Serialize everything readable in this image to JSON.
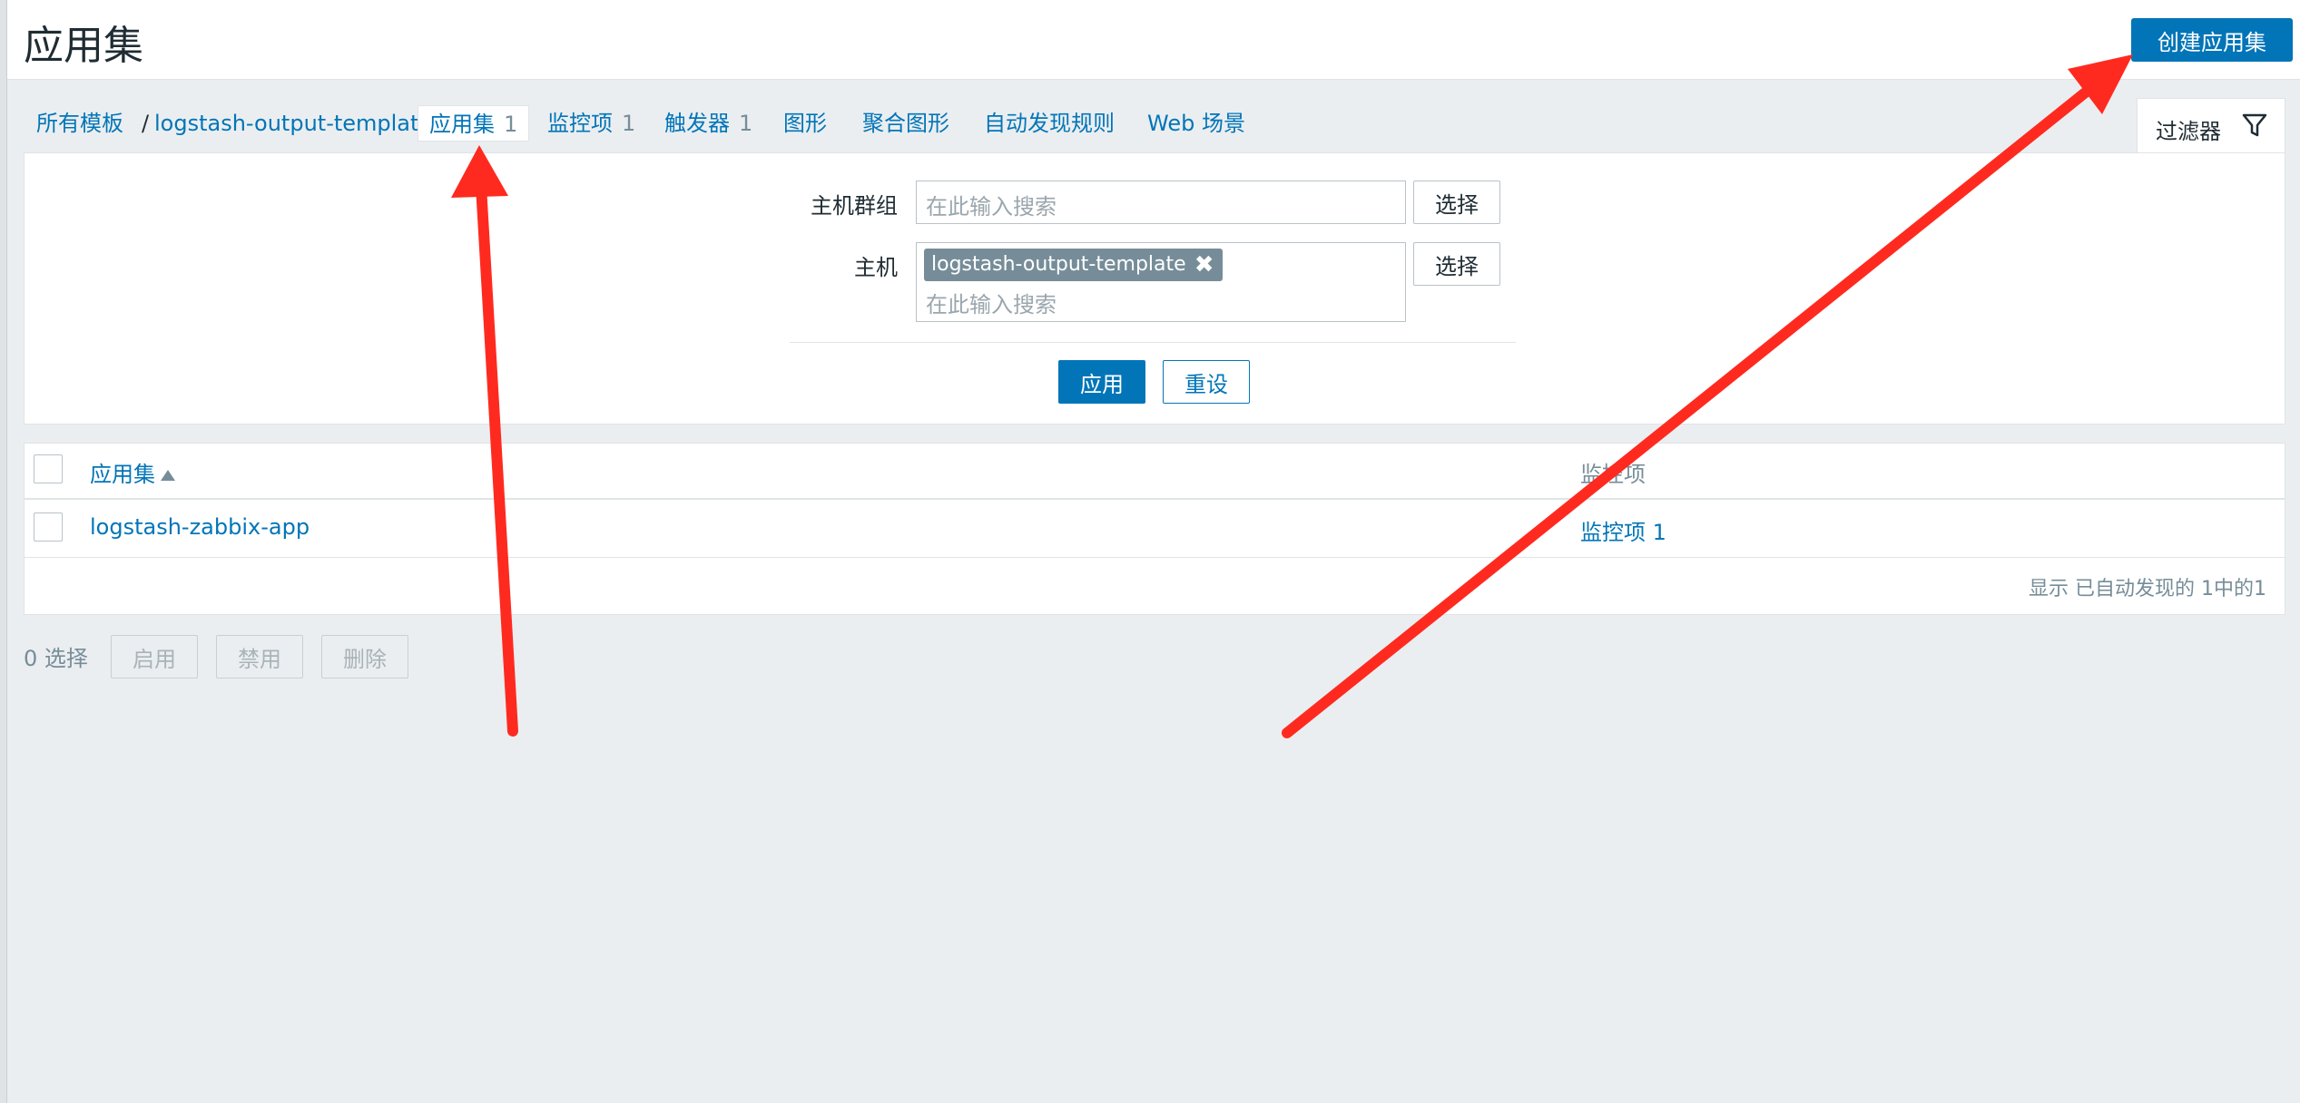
{
  "header": {
    "title": "应用集",
    "create_button": "创建应用集"
  },
  "nav": {
    "all_templates": "所有模板",
    "separator": "/",
    "template_name": "logstash-output-template",
    "tabs": [
      {
        "label": "应用集",
        "count": "1"
      },
      {
        "label": "监控项",
        "count": "1"
      },
      {
        "label": "触发器",
        "count": "1"
      },
      {
        "label": "图形",
        "count": ""
      },
      {
        "label": "聚合图形",
        "count": ""
      },
      {
        "label": "自动发现规则",
        "count": ""
      },
      {
        "label": "Web 场景",
        "count": ""
      }
    ]
  },
  "filter": {
    "tab_label": "过滤器",
    "host_group_label": "主机群组",
    "host_group_placeholder": "在此输入搜索",
    "host_label": "主机",
    "host_tag": "logstash-output-template",
    "host_placeholder": "在此输入搜索",
    "select_button": "选择",
    "apply_button": "应用",
    "reset_button": "重设"
  },
  "table": {
    "col_application": "应用集",
    "col_items": "监控项",
    "rows": [
      {
        "name": "logstash-zabbix-app",
        "items": "监控项 1"
      }
    ],
    "summary": "显示 已自动发现的 1中的1"
  },
  "actions": {
    "selected": "0 选择",
    "enable": "启用",
    "disable": "禁用",
    "delete": "删除"
  },
  "colors": {
    "accent": "#0275b8",
    "annotation_arrow": "#ff2a1f"
  }
}
